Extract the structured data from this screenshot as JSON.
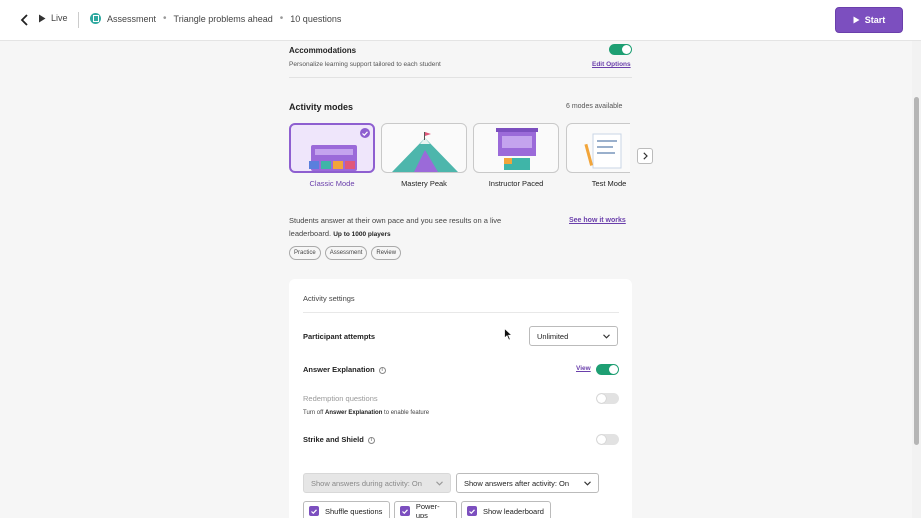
{
  "header": {
    "live_label": "Live",
    "activity_type": "Assessment",
    "quiz_title": "Triangle problems ahead",
    "question_count": "10 questions",
    "start_label": "Start",
    "separator": "•"
  },
  "accommodations": {
    "title": "Accommodations",
    "description": "Personalize learning support tailored to each student",
    "edit_label": "Edit Options",
    "enabled": true
  },
  "modes": {
    "title": "Activity modes",
    "count_label": "6 modes available",
    "items": [
      {
        "label": "Classic Mode",
        "selected": true
      },
      {
        "label": "Mastery Peak",
        "selected": false
      },
      {
        "label": "Instructor Paced",
        "selected": false
      },
      {
        "label": "Test Mode",
        "selected": false
      }
    ],
    "description_main": "Students answer at their own pace and you see results on a live leaderboard.",
    "description_bold": "Up to 1000 players",
    "see_how_label": "See how it works",
    "tags": [
      "Practice",
      "Assessment",
      "Review"
    ]
  },
  "settings": {
    "title": "Activity settings",
    "attempts_label": "Participant attempts",
    "attempts_value": "Unlimited",
    "answer_expl_label": "Answer Explanation",
    "answer_expl_view": "View",
    "answer_expl_on": true,
    "redemption_label": "Redemption questions",
    "redemption_note_pre": "Turn off",
    "redemption_note_bold": "Answer Explanation",
    "redemption_note_post": "to enable feature",
    "redemption_on": false,
    "strike_label": "Strike and Shield",
    "strike_on": false,
    "show_during": "Show answers during activity: On",
    "show_after": "Show answers after activity: On",
    "checkboxes": [
      {
        "label": "Shuffle questions",
        "checked": true
      },
      {
        "label": "Power-ups",
        "checked": true
      },
      {
        "label": "Show leaderboard",
        "checked": true
      }
    ]
  },
  "colors": {
    "accent": "#7c4fbf",
    "toggle_on": "#1e9f73",
    "badge_teal": "#2fa9a0"
  }
}
